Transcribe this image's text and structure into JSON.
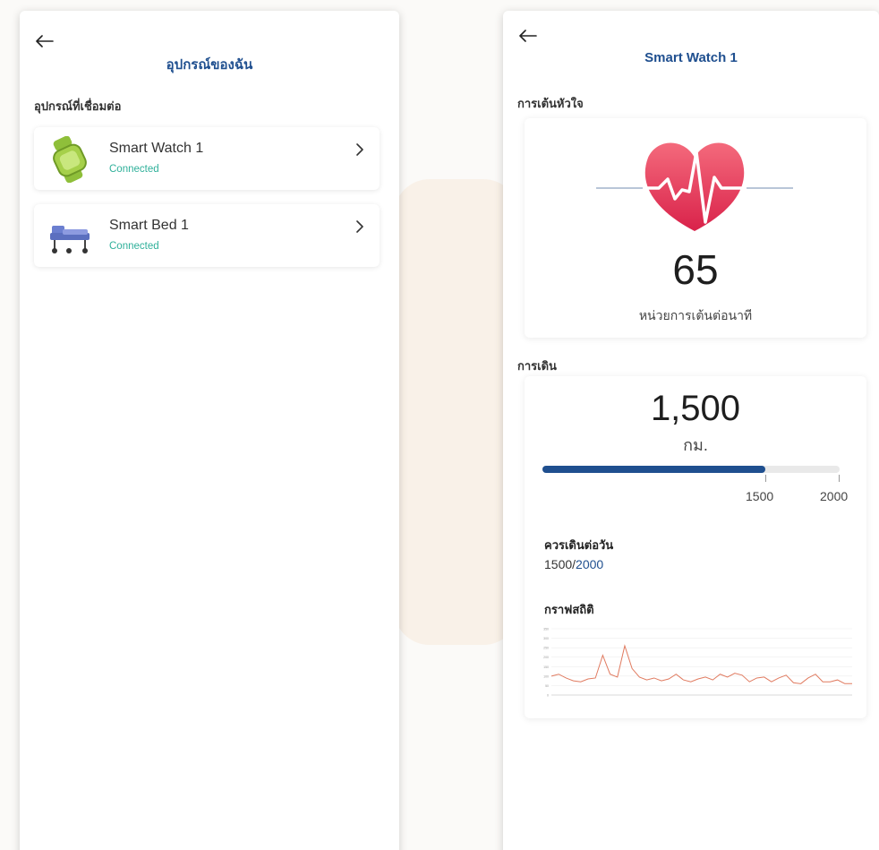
{
  "left_screen": {
    "title": "อุปกรณ์ของฉัน",
    "section_label": "อุปกรณ์ที่เชื่อมต่อ",
    "devices": [
      {
        "name": "Smart Watch 1",
        "status": "Connected",
        "icon": "smartwatch-icon"
      },
      {
        "name": "Smart Bed 1",
        "status": "Connected",
        "icon": "hospital-bed-icon"
      }
    ]
  },
  "right_screen": {
    "title": "Smart Watch 1",
    "heart_section_label": "การเต้นหัวใจ",
    "heart_rate": "65",
    "heart_rate_unit": "หน่วยการเต้นต่อนาที",
    "walk_section_label": "การเดิน",
    "distance": "1,500",
    "distance_unit": "กม.",
    "progress": {
      "current": 1500,
      "max": 2000,
      "current_label": "1500",
      "max_label": "2000"
    },
    "daily_goal_label": "ควรเดินต่อวัน",
    "daily_goal_current": "1500",
    "daily_goal_separator": "/",
    "daily_goal_target": "2000",
    "graph_label": "กราฟสถิติ"
  },
  "colors": {
    "accent": "#1f4f8f",
    "status_green": "#2fb09a",
    "heart_red": "#e8405e",
    "line_series": "#e07a5f"
  },
  "chart_data": {
    "type": "line",
    "title": "",
    "xlabel": "",
    "ylabel": "",
    "ylim": [
      0,
      350
    ],
    "yticks": [
      0,
      50,
      100,
      150,
      200,
      250,
      300,
      350
    ],
    "series": [
      {
        "values": [
          100,
          110,
          90,
          75,
          70,
          85,
          90,
          210,
          110,
          95,
          260,
          140,
          95,
          80,
          90,
          75,
          85,
          110,
          80,
          70,
          85,
          95,
          80,
          110,
          95,
          115,
          105,
          70,
          90,
          95,
          70,
          90,
          105,
          65,
          60,
          90,
          110,
          70,
          70,
          80,
          60,
          60
        ]
      }
    ]
  }
}
